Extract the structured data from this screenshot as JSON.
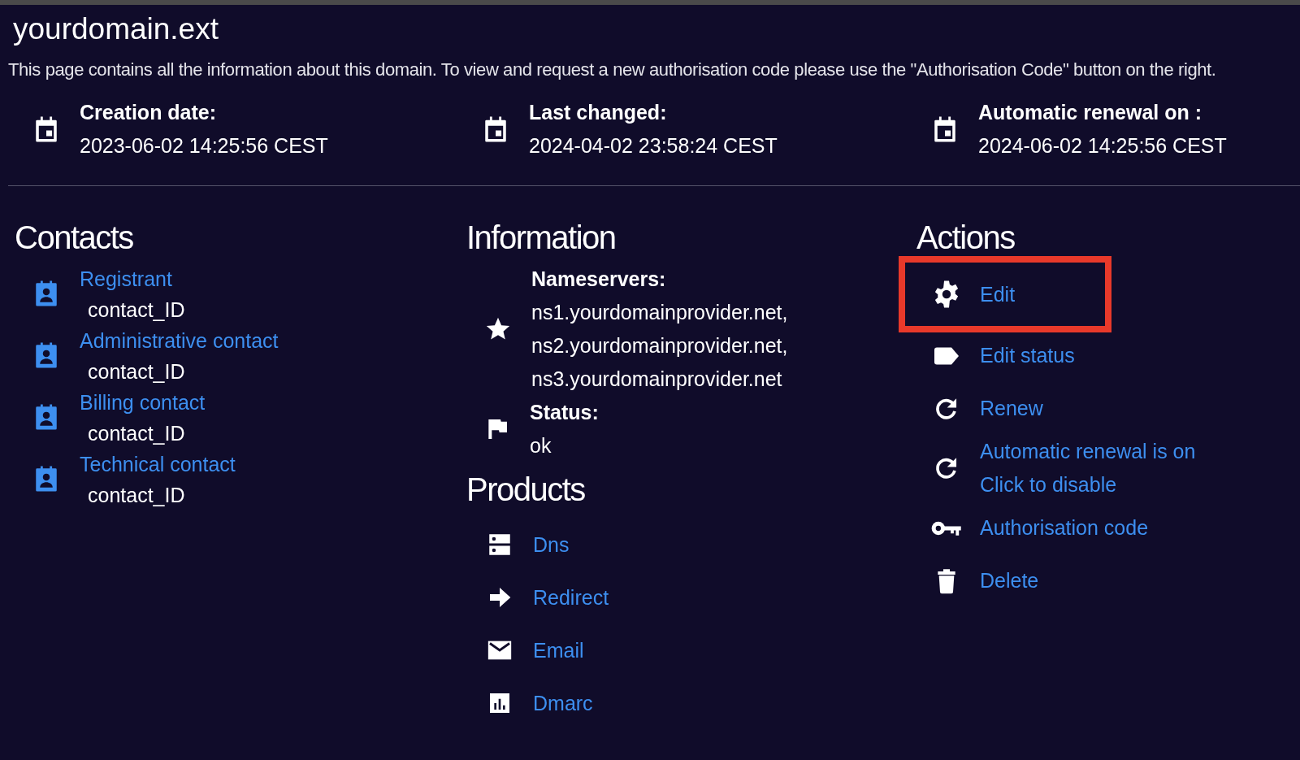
{
  "domain": {
    "title": "yourdomain.ext",
    "description": "This page contains all the information about this domain. To view and request a new authorisation code please use the \"Authorisation Code\" button on the right."
  },
  "dates": [
    {
      "label": "Creation date:",
      "value": "2023-06-02 14:25:56 CEST"
    },
    {
      "label": "Last changed:",
      "value": "2024-04-02 23:58:24 CEST"
    },
    {
      "label": "Automatic renewal on :",
      "value": "2024-06-02 14:25:56 CEST"
    }
  ],
  "contacts": {
    "heading": "Contacts",
    "items": [
      {
        "role": "Registrant",
        "value": "contact_ID"
      },
      {
        "role": "Administrative contact",
        "value": "contact_ID"
      },
      {
        "role": "Billing contact",
        "value": "contact_ID"
      },
      {
        "role": "Technical contact",
        "value": "contact_ID"
      }
    ]
  },
  "information": {
    "heading": "Information",
    "items": [
      {
        "kind": "star",
        "label": "Nameservers:",
        "values": [
          "ns1.yourdomainprovider.net,",
          "ns2.yourdomainprovider.net,",
          "ns3.yourdomainprovider.net"
        ]
      },
      {
        "kind": "flag",
        "label": "Status:",
        "values": [
          "ok"
        ]
      }
    ]
  },
  "products": {
    "heading": "Products",
    "items": [
      {
        "kind": "server",
        "label": "Dns"
      },
      {
        "kind": "arrow",
        "label": "Redirect"
      },
      {
        "kind": "mail",
        "label": "Email"
      },
      {
        "kind": "chart",
        "label": "Dmarc"
      }
    ]
  },
  "actions": {
    "heading": "Actions",
    "items": [
      {
        "kind": "gear",
        "lines": [
          "Edit"
        ],
        "highlighted": true
      },
      {
        "kind": "tag",
        "lines": [
          "Edit status"
        ],
        "highlighted": false
      },
      {
        "kind": "refresh",
        "lines": [
          "Renew"
        ],
        "highlighted": false
      },
      {
        "kind": "refresh",
        "lines": [
          "Automatic renewal is on",
          "Click to disable"
        ],
        "highlighted": false
      },
      {
        "kind": "key",
        "lines": [
          "Authorisation code"
        ],
        "highlighted": false
      },
      {
        "kind": "trash",
        "lines": [
          "Delete"
        ],
        "highlighted": false
      }
    ]
  }
}
